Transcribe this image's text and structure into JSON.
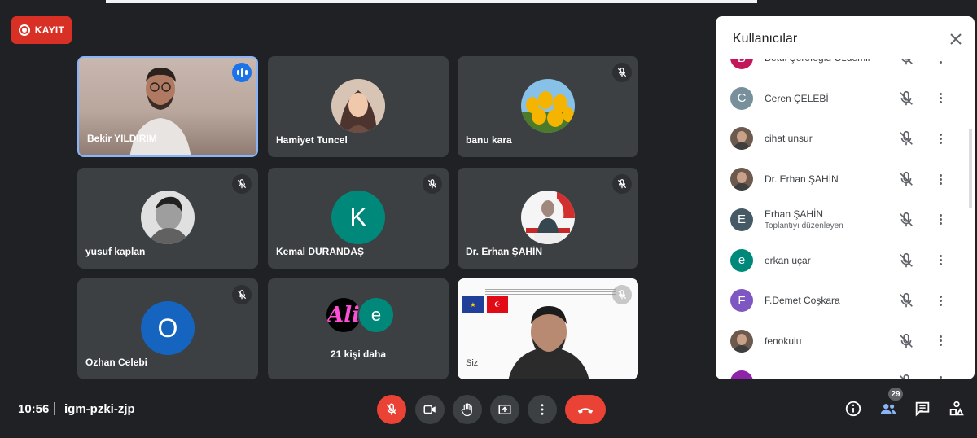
{
  "recording": {
    "label": "KAYIT",
    "color": "#d93025"
  },
  "tiles": [
    {
      "name": "Bekir YILDIRIM",
      "speaking": true
    },
    {
      "name": "Hamiyet Tuncel"
    },
    {
      "name": "banu kara",
      "muted": true
    },
    {
      "name": "yusuf kaplan",
      "muted": true
    },
    {
      "name": "Kemal DURANDAŞ",
      "initial": "K",
      "color": "#00897b",
      "muted": true
    },
    {
      "name": "Dr. Erhan ŞAHİN",
      "muted": true
    },
    {
      "name": "Ozhan Celebi",
      "initial": "O",
      "color": "#1565c0",
      "muted": true
    },
    {
      "more_label": "21 kişi daha",
      "initials": [
        "Ali",
        "e"
      ]
    },
    {
      "name": "Siz",
      "muted": true
    }
  ],
  "panel": {
    "title": "Kullanıcılar",
    "participants": [
      {
        "name": "Betül Şerefoğlu Özdemir",
        "initial": "B",
        "color": "#c2185b"
      },
      {
        "name": "Ceren ÇELEBİ",
        "initial": "C",
        "color": "#78909c"
      },
      {
        "name": "cihat unsur",
        "photo": true
      },
      {
        "name": "Dr. Erhan ŞAHİN",
        "photo": true
      },
      {
        "name": "Erhan ŞAHİN",
        "initial": "E",
        "color": "#455a64",
        "subtitle": "Toplantıyı düzenleyen"
      },
      {
        "name": "erkan uçar",
        "initial": "e",
        "color": "#00897b"
      },
      {
        "name": "F.Demet Coşkara",
        "initial": "F",
        "color": "#7e57c2"
      },
      {
        "name": "fenokulu",
        "photo": true
      },
      {
        "name": "",
        "initial": "",
        "color": "#8e24aa"
      }
    ]
  },
  "meeting": {
    "time": "10:56",
    "code": "igm-pzki-zjp",
    "participant_count": "29"
  },
  "controls": [
    "mic-off-icon",
    "camera-icon",
    "raise-hand-icon",
    "present-screen-icon",
    "more-options-icon",
    "end-call-icon"
  ],
  "right_icons": [
    "info-icon",
    "people-icon",
    "chat-icon",
    "activities-icon"
  ]
}
